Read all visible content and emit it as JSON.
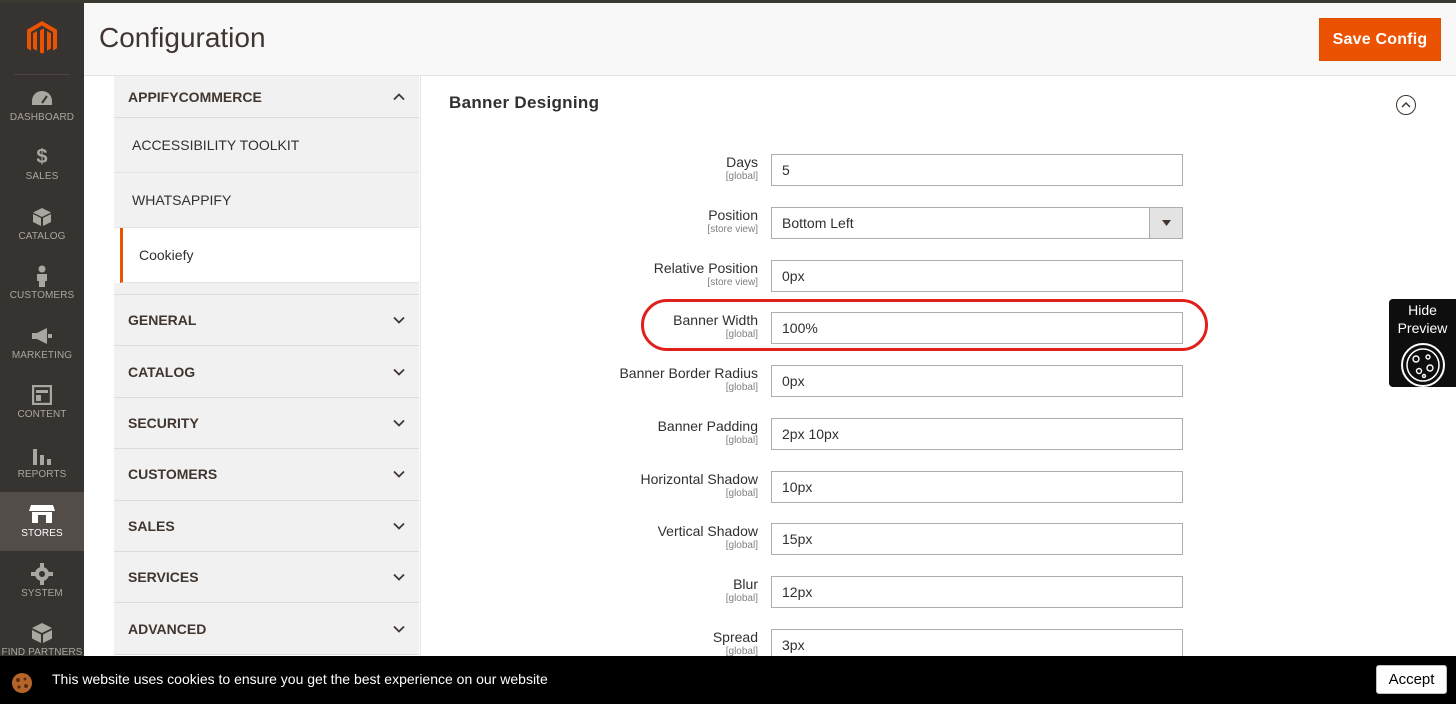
{
  "nav": {
    "items": [
      {
        "label": "DASHBOARD",
        "icon": "dashboard-icon"
      },
      {
        "label": "SALES",
        "icon": "dollar-icon"
      },
      {
        "label": "CATALOG",
        "icon": "box-icon"
      },
      {
        "label": "CUSTOMERS",
        "icon": "person-icon"
      },
      {
        "label": "MARKETING",
        "icon": "megaphone-icon"
      },
      {
        "label": "CONTENT",
        "icon": "layout-icon"
      },
      {
        "label": "REPORTS",
        "icon": "bar-chart-icon"
      },
      {
        "label": "STORES",
        "icon": "store-icon"
      },
      {
        "label": "SYSTEM",
        "icon": "gear-icon"
      },
      {
        "label": "FIND PARTNERS",
        "icon": "cube-icon"
      }
    ],
    "active": "STORES"
  },
  "header": {
    "title": "Configuration",
    "save_label": "Save Config"
  },
  "tabs": {
    "appify": {
      "label": "APPIFYCOMMERCE"
    },
    "sub_items": [
      "ACCESSIBILITY TOOLKIT",
      "WHATSAPPIFY",
      "Cookiefy"
    ],
    "groups": [
      "GENERAL",
      "CATALOG",
      "SECURITY",
      "CUSTOMERS",
      "SALES",
      "SERVICES",
      "ADVANCED"
    ]
  },
  "section": {
    "title": "Banner Designing"
  },
  "fields": [
    {
      "label": "Days",
      "scope": "[global]",
      "value": "5"
    },
    {
      "label": "Position",
      "scope": "[store view]",
      "value": "Bottom Left",
      "type": "select"
    },
    {
      "label": "Relative Position",
      "scope": "[store view]",
      "value": "0px"
    },
    {
      "label": "Banner Width",
      "scope": "[global]",
      "value": "100%"
    },
    {
      "label": "Banner Border Radius",
      "scope": "[global]",
      "value": "0px"
    },
    {
      "label": "Banner Padding",
      "scope": "[global]",
      "value": "2px 10px"
    },
    {
      "label": "Horizontal Shadow",
      "scope": "[global]",
      "value": "10px"
    },
    {
      "label": "Vertical Shadow",
      "scope": "[global]",
      "value": "15px"
    },
    {
      "label": "Blur",
      "scope": "[global]",
      "value": "12px"
    },
    {
      "label": "Spread",
      "scope": "[global]",
      "value": "3px"
    }
  ],
  "preview": {
    "label_line1": "Hide",
    "label_line2": "Preview"
  },
  "cookie_banner": {
    "text": "This website uses cookies to ensure you get the best experience on our website",
    "accept_label": "Accept"
  },
  "colors": {
    "accent": "#eb5202",
    "nav_bg": "#373330",
    "highlight": "#e0201c"
  }
}
